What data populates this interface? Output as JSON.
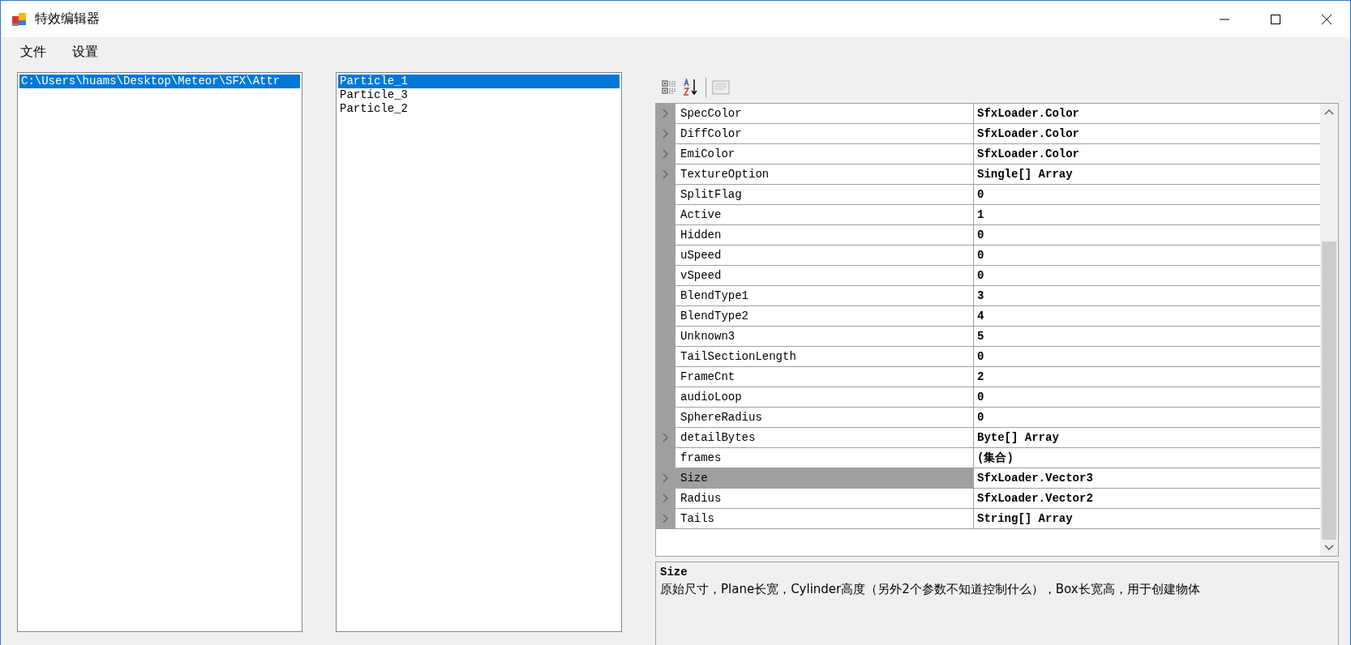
{
  "window": {
    "title": "特效编辑器"
  },
  "menu": [
    {
      "label": "文件"
    },
    {
      "label": "设置"
    }
  ],
  "file_list": [
    {
      "label": "C:\\Users\\huams\\Desktop\\Meteor\\SFX\\Attr",
      "selected": true
    }
  ],
  "particle_list": [
    {
      "label": "Particle_1",
      "selected": true
    },
    {
      "label": "Particle_3",
      "selected": false
    },
    {
      "label": "Particle_2",
      "selected": false
    }
  ],
  "property_grid": {
    "rows": [
      {
        "name": "SpecColor",
        "value": "SfxLoader.Color",
        "expandable": true,
        "selected": false
      },
      {
        "name": "DiffColor",
        "value": "SfxLoader.Color",
        "expandable": true,
        "selected": false
      },
      {
        "name": "EmiColor",
        "value": "SfxLoader.Color",
        "expandable": true,
        "selected": false
      },
      {
        "name": "TextureOption",
        "value": "Single[] Array",
        "expandable": true,
        "selected": false
      },
      {
        "name": "SplitFlag",
        "value": "0",
        "expandable": false,
        "selected": false
      },
      {
        "name": "Active",
        "value": "1",
        "expandable": false,
        "selected": false
      },
      {
        "name": "Hidden",
        "value": "0",
        "expandable": false,
        "selected": false
      },
      {
        "name": "uSpeed",
        "value": "0",
        "expandable": false,
        "selected": false
      },
      {
        "name": "vSpeed",
        "value": "0",
        "expandable": false,
        "selected": false
      },
      {
        "name": "BlendType1",
        "value": "3",
        "expandable": false,
        "selected": false
      },
      {
        "name": "BlendType2",
        "value": "4",
        "expandable": false,
        "selected": false
      },
      {
        "name": "Unknown3",
        "value": "5",
        "expandable": false,
        "selected": false
      },
      {
        "name": "TailSectionLength",
        "value": "0",
        "expandable": false,
        "selected": false
      },
      {
        "name": "FrameCnt",
        "value": "2",
        "expandable": false,
        "selected": false
      },
      {
        "name": "audioLoop",
        "value": "0",
        "expandable": false,
        "selected": false
      },
      {
        "name": "SphereRadius",
        "value": "0",
        "expandable": false,
        "selected": false
      },
      {
        "name": "detailBytes",
        "value": "Byte[] Array",
        "expandable": true,
        "selected": false
      },
      {
        "name": "frames",
        "value": "(集合)",
        "expandable": false,
        "selected": false
      },
      {
        "name": "Size",
        "value": "SfxLoader.Vector3",
        "expandable": true,
        "selected": true
      },
      {
        "name": "Radius",
        "value": "SfxLoader.Vector2",
        "expandable": true,
        "selected": false
      },
      {
        "name": "Tails",
        "value": "String[] Array",
        "expandable": true,
        "selected": false
      }
    ],
    "description": {
      "title": "Size",
      "text": "原始尺寸，Plane长宽，Cylinder高度（另外2个参数不知道控制什么），Box长宽高，用于创建物体"
    }
  }
}
